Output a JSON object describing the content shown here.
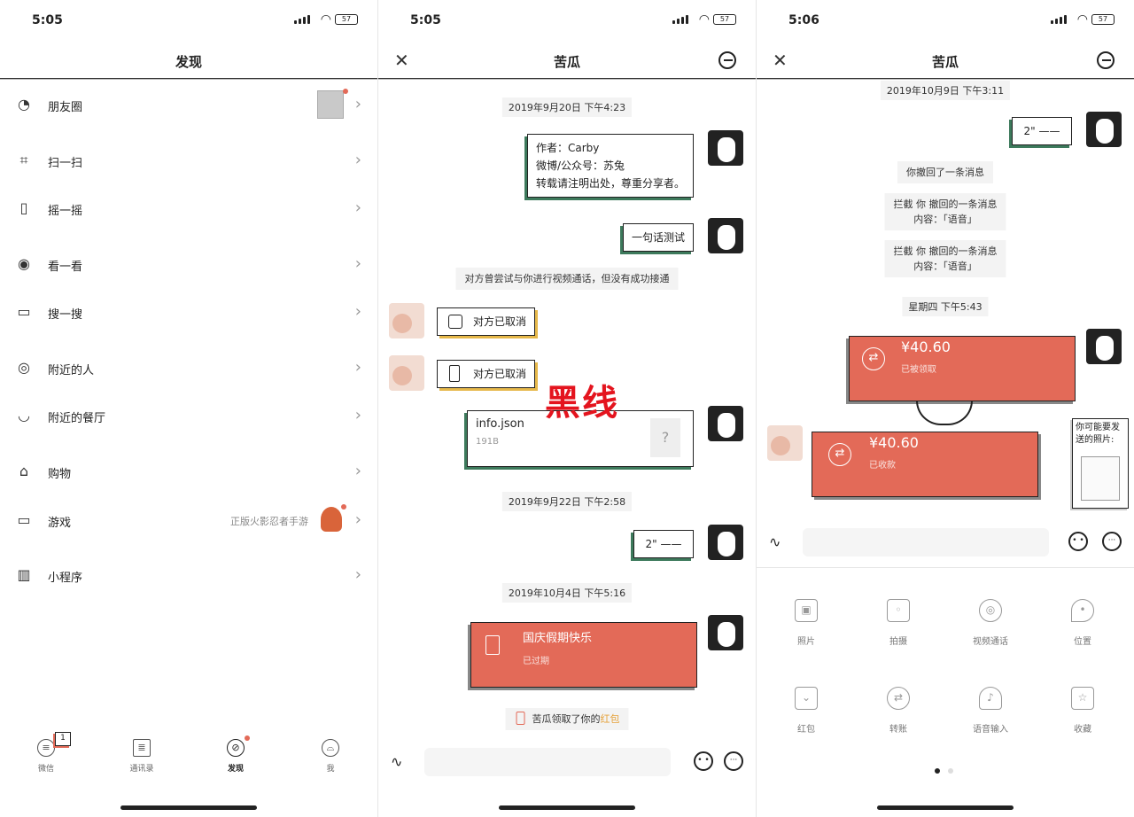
{
  "status": {
    "s1_time": "5:05",
    "s2_time": "5:05",
    "s3_time": "5:06",
    "battery": "57"
  },
  "discover": {
    "title": "发现",
    "items": [
      {
        "label": "朋友圈",
        "icon": "moments-icon"
      },
      {
        "label": "扫一扫",
        "icon": "scan-icon"
      },
      {
        "label": "摇一摇",
        "icon": "shake-icon"
      },
      {
        "label": "看一看",
        "icon": "eye-icon"
      },
      {
        "label": "搜一搜",
        "icon": "search-icon"
      },
      {
        "label": "附近的人",
        "icon": "location-icon"
      },
      {
        "label": "附近的餐厅",
        "icon": "restaurant-icon"
      },
      {
        "label": "购物",
        "icon": "shop-icon"
      },
      {
        "label": "游戏",
        "icon": "game-icon",
        "side": "正版火影忍者手游"
      },
      {
        "label": "小程序",
        "icon": "miniprogram-icon"
      }
    ],
    "tabs": [
      {
        "label": "微信",
        "badge": "1"
      },
      {
        "label": "通讯录"
      },
      {
        "label": "发现"
      },
      {
        "label": "我"
      }
    ]
  },
  "chat1": {
    "title": "苦瓜",
    "stamp1": "2019年9月20日 下午4:23",
    "intro": [
      "作者：Carby",
      "微博/公众号：苏兔",
      "转载请注明出处，尊重分享者。"
    ],
    "msg_test": "一句话测试",
    "video_notice": "对方曾尝试与你进行视频通话，但没有成功接通",
    "cancel1": "对方已取消",
    "cancel2": "对方已取消",
    "file_name": "info.json",
    "file_size": "191B",
    "overlay": "黑线",
    "stamp2": "2019年9月22日 下午2:58",
    "voice": "2\" ——",
    "stamp3": "2019年10月4日 下午5:16",
    "packet_title": "国庆假期快乐",
    "packet_status": "已过期",
    "notice_pre": "苦瓜领取了你的",
    "notice_link": "红包"
  },
  "chat2": {
    "title": "苦瓜",
    "stamp1": "2019年10月9日 下午3:11",
    "voice": "2\" ——",
    "recall": "你撤回了一条消息",
    "intercept1": [
      "拦截 你 撤回的一条消息",
      "内容：「语音」"
    ],
    "intercept2": [
      "拦截 你 撤回的一条消息",
      "内容：「语音」"
    ],
    "stamp2": "星期四 下午5:43",
    "transfer1_amount": "¥40.60",
    "transfer1_status": "已被领取",
    "transfer2_amount": "¥40.60",
    "transfer2_status": "已收款",
    "maybe_send": "你可能要发送的照片:",
    "panel": [
      "照片",
      "拍摄",
      "视频通话",
      "位置",
      "红包",
      "转账",
      "语音输入",
      "收藏"
    ]
  },
  "colors": {
    "accent_red": "#e36a58",
    "bubble_green": "#3d7a5c",
    "bubble_yellow": "#e6b84a",
    "overlay_red": "#e4141e"
  }
}
